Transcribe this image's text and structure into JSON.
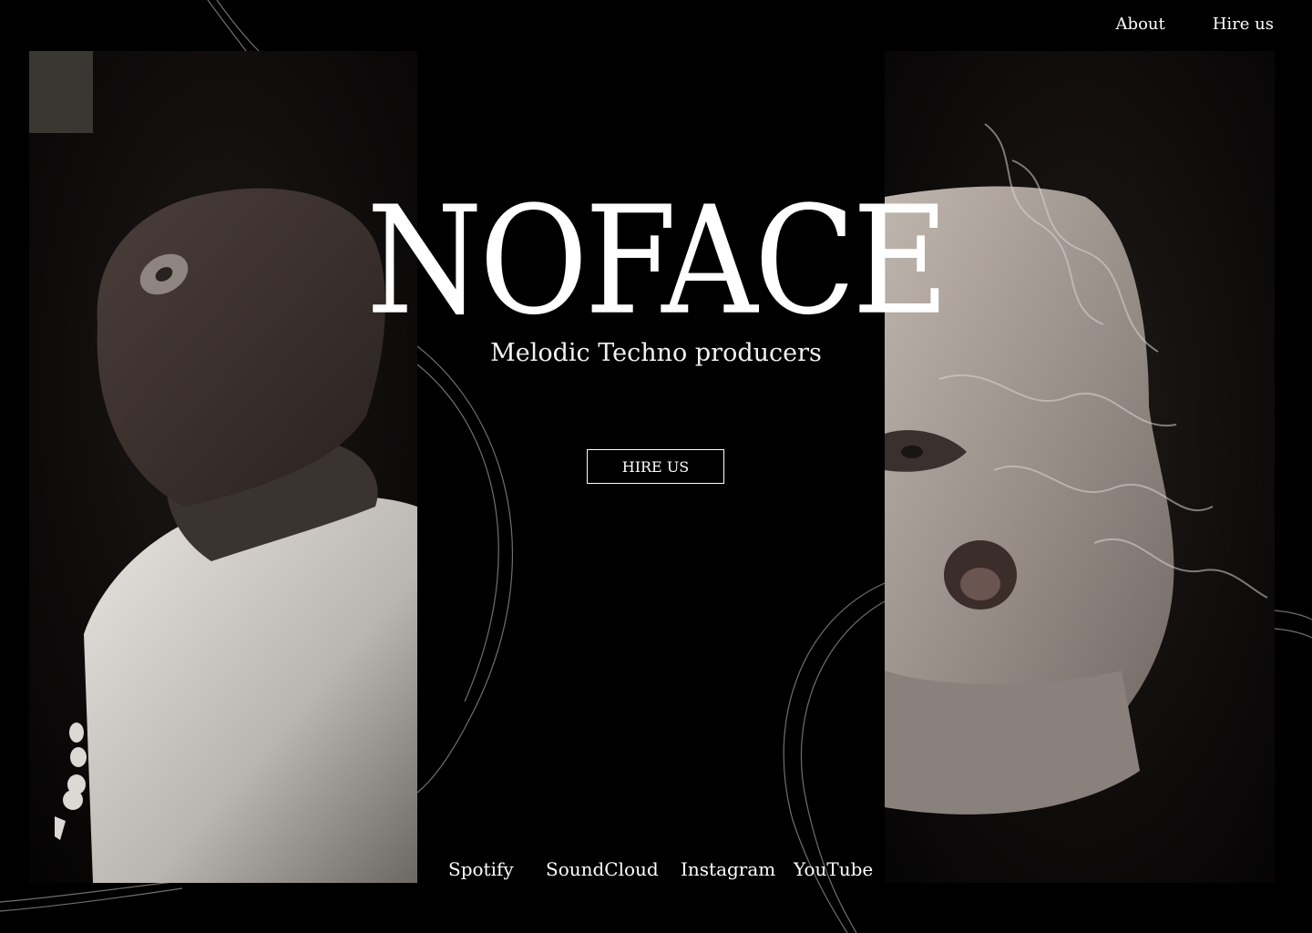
{
  "nav": {
    "items": [
      {
        "label": "About"
      },
      {
        "label": "Hire us"
      }
    ]
  },
  "hero": {
    "title": "NOFACE",
    "subtitle": "Melodic Techno producers",
    "cta_label": "HIRE US"
  },
  "socials": {
    "items": [
      {
        "label": "Spotify"
      },
      {
        "label": "SoundCloud"
      },
      {
        "label": "Instagram"
      },
      {
        "label": "YouTube"
      }
    ]
  },
  "colors": {
    "background": "#000000",
    "text": "#ffffff",
    "line": "#8a8a8a"
  }
}
